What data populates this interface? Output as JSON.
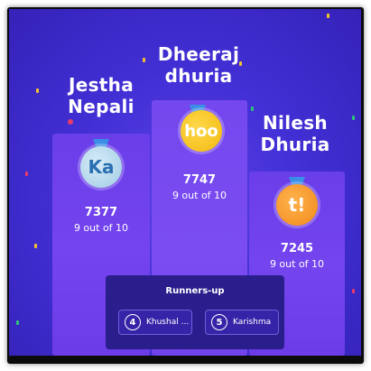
{
  "leaderboard": {
    "first": {
      "name_line1": "Dheeraj",
      "name_line2": "dhuria",
      "avatar_text": "hoo",
      "score": "7747",
      "correct": "9 out of 10"
    },
    "second": {
      "name_line1": "Jestha",
      "name_line2": "Nepali",
      "avatar_text": "Ka",
      "score": "7377",
      "correct": "9 out of 10"
    },
    "third": {
      "name_line1": "Nilesh",
      "name_line2": "Dhuria",
      "avatar_text": "t!",
      "score": "7245",
      "correct": "9 out of 10"
    }
  },
  "runners_up": {
    "title": "Runners-up",
    "items": [
      {
        "rank": "4",
        "name": "Khushal ..."
      },
      {
        "rank": "5",
        "name": "Karishma"
      }
    ]
  },
  "colors": {
    "background": "#4330d6",
    "podium": "#7444ee",
    "panel": "#2a1e8c",
    "avatar_first": "#f2b90f",
    "avatar_second": "#9fcbe4",
    "avatar_third": "#f08a1a"
  }
}
